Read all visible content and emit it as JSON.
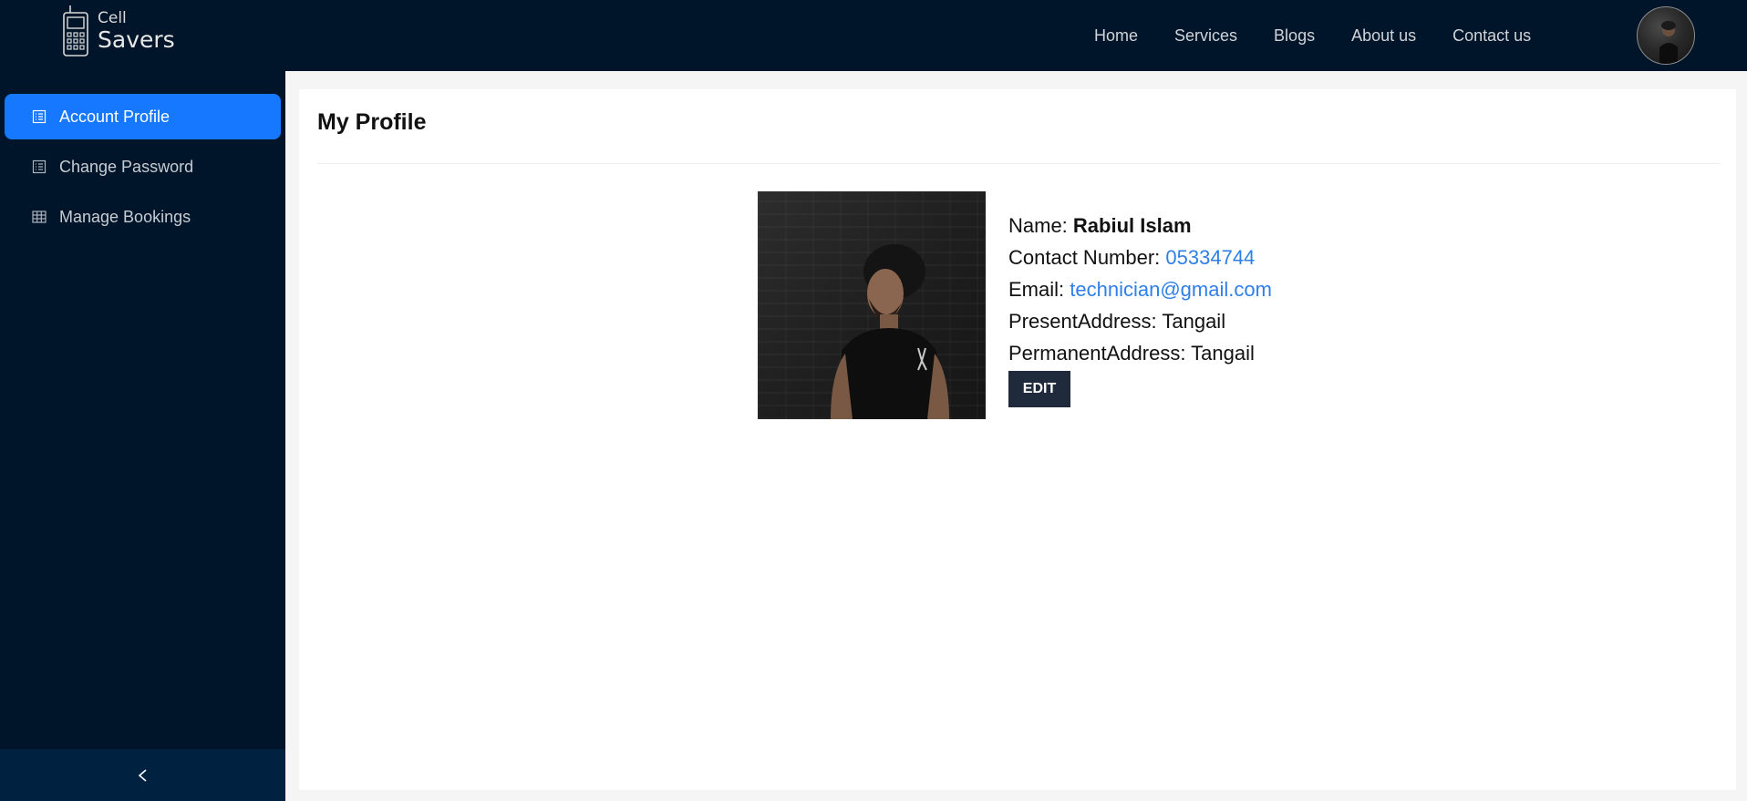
{
  "brand": {
    "line1": "Cell",
    "line2": "Savers"
  },
  "nav": {
    "items": [
      {
        "label": "Home"
      },
      {
        "label": "Services"
      },
      {
        "label": "Blogs"
      },
      {
        "label": "About us"
      },
      {
        "label": "Contact us"
      }
    ]
  },
  "sidebar": {
    "items": [
      {
        "label": "Account Profile",
        "icon": "list-icon",
        "active": true
      },
      {
        "label": "Change Password",
        "icon": "list-icon",
        "active": false
      },
      {
        "label": "Manage Bookings",
        "icon": "table-icon",
        "active": false
      }
    ],
    "collapse_glyph": "<"
  },
  "profile": {
    "title": "My Profile",
    "name_label": "Name: ",
    "name": "Rabiul Islam",
    "contact_label": "Contact Number: ",
    "contact": "05334744",
    "email_label": "Email: ",
    "email": "technician@gmail.com",
    "present_label": "PresentAddress: ",
    "present": "Tangail",
    "permanent_label": "PermanentAddress: ",
    "permanent": "Tangail",
    "edit_label": "EDIT"
  },
  "colors": {
    "header_bg": "#001529",
    "sidebar_bg": "#001529",
    "active_item": "#1677ff",
    "link": "#2f7fe8",
    "button_bg": "#1f2a3c"
  }
}
